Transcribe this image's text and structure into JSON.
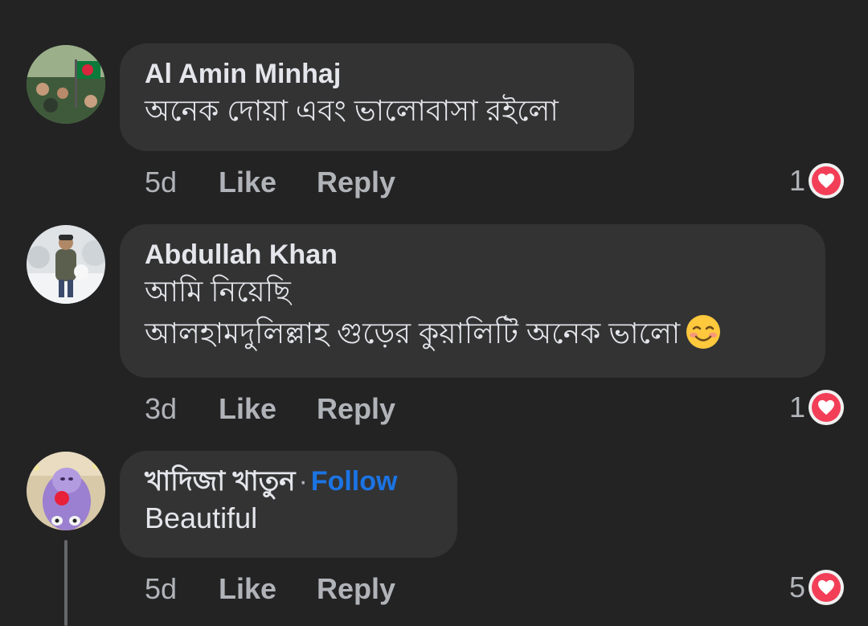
{
  "comments": [
    {
      "author": "Al Amin Minhaj",
      "lines": [
        "অনেক দোয়া এবং ভালোবাসা রইলো"
      ],
      "time": "5d",
      "like_label": "Like",
      "reply_label": "Reply",
      "reaction_count": "1",
      "reaction_icon": "heart-icon"
    },
    {
      "author": "Abdullah Khan",
      "lines": [
        "আমি নিয়েছি",
        "আলহামদুলিল্লাহ গুড়ের কুয়ালিটি অনেক ভালো"
      ],
      "emoji": "☺️",
      "time": "3d",
      "like_label": "Like",
      "reply_label": "Reply",
      "reaction_count": "1",
      "reaction_icon": "heart-icon"
    },
    {
      "author": "খাদিজা খাতুন",
      "separator": "·",
      "follow_label": "Follow",
      "lines": [
        "Beautiful"
      ],
      "time": "5d",
      "like_label": "Like",
      "reply_label": "Reply",
      "reaction_count": "5",
      "reaction_icon": "heart-icon"
    }
  ],
  "colors": {
    "background": "#232324",
    "bubble": "#333334",
    "text": "#e4e6eb",
    "secondary_text": "#b0b3b8",
    "link": "#1b74e4",
    "heart": "#f33e58"
  }
}
